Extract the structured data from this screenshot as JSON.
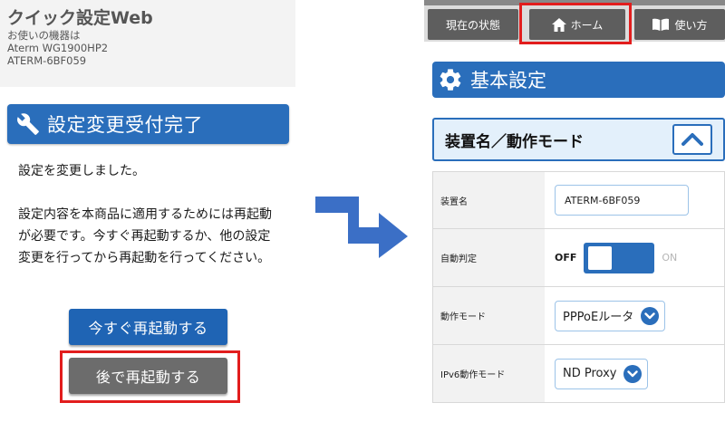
{
  "left": {
    "app_title": "クイック設定Web",
    "device_label": "お使いの機器は",
    "model": "Aterm WG1900HP2",
    "device_id": "ATERM-6BF059",
    "section_title": "設定変更受付完了",
    "message1": "設定を変更しました。",
    "message2": "設定内容を本商品に適用するためには再起動が必要です。今すぐ再起動するか、他の設定変更を行ってから再起動を行ってください。",
    "restart_now_label": "今すぐ再起動する",
    "restart_later_label": "後で再起動する"
  },
  "right": {
    "tabs": {
      "status": "現在の状態",
      "home": "ホーム",
      "guide": "使い方"
    },
    "basic_title": "基本設定",
    "accordion_title": "装置名／動作モード",
    "rows": [
      {
        "label": "装置名",
        "value": "ATERM-6BF059"
      },
      {
        "label": "自動判定",
        "off": "OFF",
        "on": "ON"
      },
      {
        "label": "動作モード",
        "value": "PPPoEルータ"
      },
      {
        "label": "IPv6動作モード",
        "value": "ND Proxy"
      }
    ]
  },
  "colors": {
    "accent_blue": "#2a6ebb",
    "button_gray": "#6c6c6c",
    "highlight_red": "#e21d1d"
  },
  "icons": [
    "wrench-icon",
    "home-icon",
    "book-icon",
    "gear-icon",
    "chevron-up-icon",
    "chevron-down-icon",
    "arrow-icon"
  ]
}
